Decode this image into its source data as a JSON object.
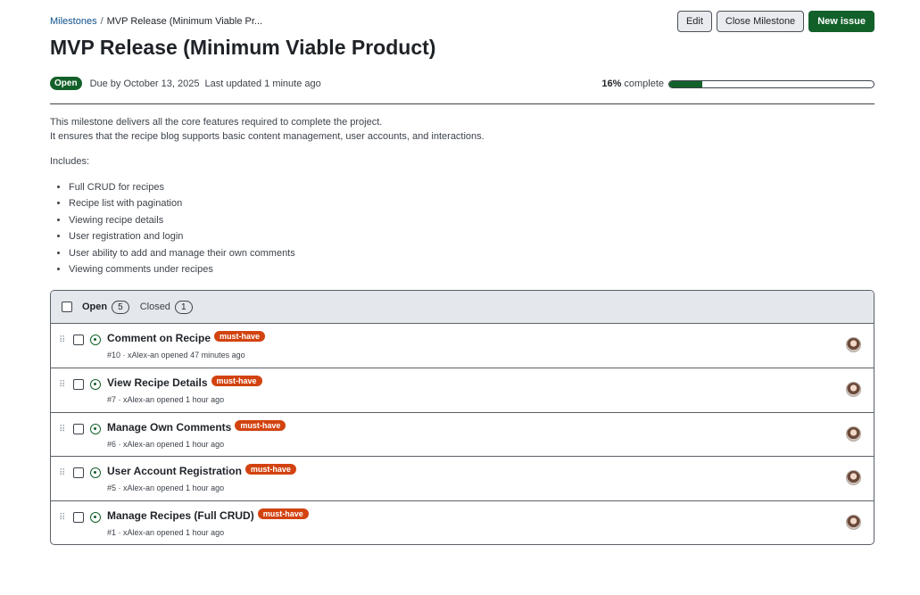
{
  "breadcrumb": {
    "parent": "Milestones",
    "separator": "/",
    "current": "MVP Release (Minimum Viable Pr..."
  },
  "actions": {
    "edit": "Edit",
    "close_milestone": "Close Milestone",
    "new_issue": "New issue"
  },
  "milestone": {
    "title": "MVP Release (Minimum Viable Product)",
    "state": "Open",
    "due": "Due by October 13, 2025",
    "updated": "Last updated 1 minute ago",
    "progress_pct": "16%",
    "progress_label": "complete",
    "progress_fraction": 0.16
  },
  "description": {
    "line1": "This milestone delivers all the core features required to complete the project.",
    "line2": "It ensures that the recipe blog supports basic content management, user accounts, and interactions.",
    "includes": "Includes:",
    "items": [
      "Full CRUD for recipes",
      "Recipe list with pagination",
      "Viewing recipe details",
      "User registration and login",
      "User ability to add and manage their own comments",
      "Viewing comments under recipes"
    ]
  },
  "issues": {
    "open_label": "Open",
    "open_count": "5",
    "closed_label": "Closed",
    "closed_count": "1",
    "rows": [
      {
        "title": "Comment on Recipe",
        "label": "must-have",
        "meta": "#10 · xAlex-an opened 47 minutes ago"
      },
      {
        "title": "View Recipe Details",
        "label": "must-have",
        "meta": "#7 · xAlex-an opened 1 hour ago"
      },
      {
        "title": "Manage Own Comments",
        "label": "must-have",
        "meta": "#6 · xAlex-an opened 1 hour ago"
      },
      {
        "title": "User Account Registration",
        "label": "must-have",
        "meta": "#5 · xAlex-an opened 1 hour ago"
      },
      {
        "title": "Manage Recipes (Full CRUD)",
        "label": "must-have",
        "meta": "#1 · xAlex-an opened 1 hour ago"
      }
    ]
  },
  "colors": {
    "primary_green": "#13612a",
    "label_orange": "#d24310",
    "link_blue": "#0b4f8a"
  }
}
